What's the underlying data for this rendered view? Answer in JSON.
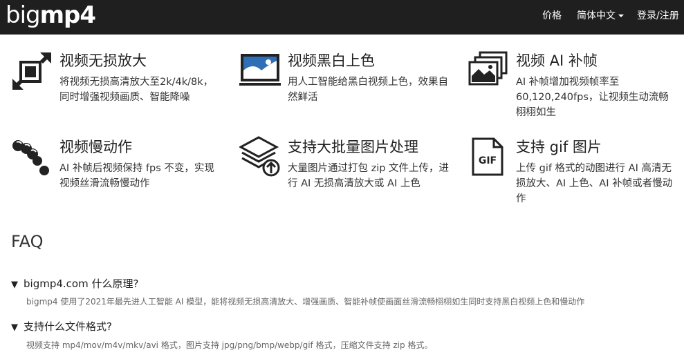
{
  "nav": {
    "brand_light": "big",
    "brand_bold": "mp4",
    "pricing": "价格",
    "language": "简体中文",
    "login": "登录/注册"
  },
  "features": [
    {
      "icon": "expand-arrows-icon",
      "title": "视频无损放大",
      "desc": "将视频无损高清放大至2k/4k/8k，同时增强视频画质、智能降噪"
    },
    {
      "icon": "colorized-image-icon",
      "title": "视频黑白上色",
      "desc": "用人工智能给黑白视频上色，效果自然鲜活"
    },
    {
      "icon": "stacked-images-icon",
      "title": "视频 AI 补帧",
      "desc": "AI 补帧增加视频帧率至60,120,240fps，让视频生动流畅栩栩如生"
    },
    {
      "icon": "slow-motion-balls-icon",
      "title": "视频慢动作",
      "desc": "AI 补帧后视频保持 fps 不变，实现视频丝滑流畅慢动作"
    },
    {
      "icon": "layers-upload-icon",
      "title": "支持大批量图片处理",
      "desc": "大量图片通过打包 zip 文件上传，进行 AI 无损高清放大或 AI 上色"
    },
    {
      "icon": "gif-file-icon",
      "title": "支持 gif 图片",
      "desc": "上传 gif 格式的动图进行 AI 高清无损放大、AI 上色、AI 补帧或者慢动作"
    }
  ],
  "faq": {
    "heading": "FAQ",
    "items": [
      {
        "question": "bigmp4.com 什么原理?",
        "answer": "bigmp4 使用了2021年最先进人工智能 AI 模型，能将视频无损高清放大、增强画质、智能补帧使画面丝滑流畅栩栩如生同时支持黑白视频上色和慢动作"
      },
      {
        "question": "支持什么文件格式?",
        "answer": "视频支持 mp4/mov/m4v/mkv/avi 格式，图片支持 jpg/png/bmp/webp/gif 格式，压缩文件支持 zip 格式。"
      }
    ]
  },
  "colors": {
    "navbar": "#1f1f1f",
    "icon_blue": "#2f6fb5"
  }
}
